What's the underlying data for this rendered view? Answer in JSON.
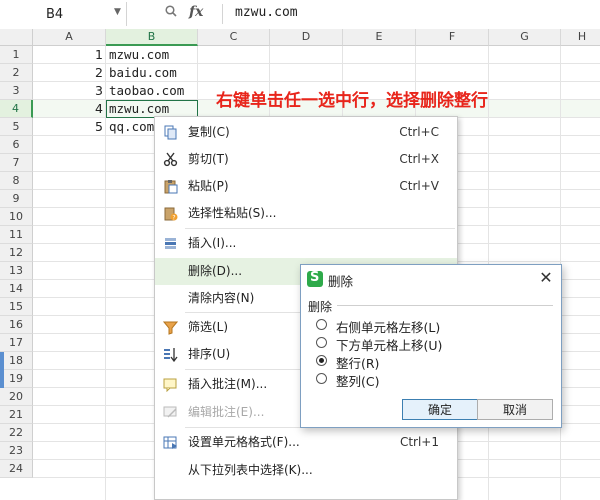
{
  "formula_bar": {
    "name_box": "B4",
    "fx_label": "fx",
    "content": "mzwu.com"
  },
  "columns": [
    "A",
    "B",
    "C",
    "D",
    "E",
    "F",
    "G",
    "H"
  ],
  "rows": [
    "1",
    "2",
    "3",
    "4",
    "5",
    "6",
    "7",
    "8",
    "9",
    "10",
    "11",
    "12",
    "13",
    "14",
    "15",
    "16",
    "17",
    "18",
    "19",
    "20",
    "21",
    "22",
    "23",
    "24"
  ],
  "cells": {
    "A": [
      "1",
      "2",
      "3",
      "4",
      "5"
    ],
    "B": [
      "mzwu.com",
      "baidu.com",
      "taobao.com",
      "mzwu.com",
      "qq.com"
    ]
  },
  "annotation": "右键单击任一选中行，选择删除整行",
  "context_menu": {
    "items": [
      {
        "label": "复制(C)",
        "shortcut": "Ctrl+C",
        "icon": "copy-icon"
      },
      {
        "label": "剪切(T)",
        "shortcut": "Ctrl+X",
        "icon": "scissors-icon"
      },
      {
        "label": "粘贴(P)",
        "shortcut": "Ctrl+V",
        "icon": "paste-icon"
      },
      {
        "label": "选择性粘贴(S)...",
        "shortcut": "",
        "icon": "paste-special-icon"
      },
      {
        "label": "插入(I)...",
        "shortcut": "",
        "icon": "insert-icon"
      },
      {
        "label": "删除(D)...",
        "shortcut": "",
        "icon": ""
      },
      {
        "label": "清除内容(N)",
        "shortcut": "",
        "icon": ""
      },
      {
        "label": "筛选(L)",
        "shortcut": "",
        "icon": "filter-icon"
      },
      {
        "label": "排序(U)",
        "shortcut": "",
        "icon": "sort-icon"
      },
      {
        "label": "插入批注(M)...",
        "shortcut": "",
        "icon": "comment-icon"
      },
      {
        "label": "编辑批注(E)...",
        "shortcut": "",
        "icon": "edit-comment-icon"
      },
      {
        "label": "设置单元格格式(F)...",
        "shortcut": "Ctrl+1",
        "icon": "format-cells-icon"
      },
      {
        "label": "从下拉列表中选择(K)...",
        "shortcut": "",
        "icon": ""
      }
    ]
  },
  "delete_dialog": {
    "title": "删除",
    "group_label": "删除",
    "options": [
      {
        "label": "右侧单元格左移(L)",
        "selected": false
      },
      {
        "label": "下方单元格上移(U)",
        "selected": false
      },
      {
        "label": "整行(R)",
        "selected": true
      },
      {
        "label": "整列(C)",
        "selected": false
      }
    ],
    "ok_label": "确定",
    "cancel_label": "取消"
  },
  "colors": {
    "accent_green": "#217346",
    "annotation_red": "#e8251b",
    "menu_hover": "#e6f2e2"
  }
}
